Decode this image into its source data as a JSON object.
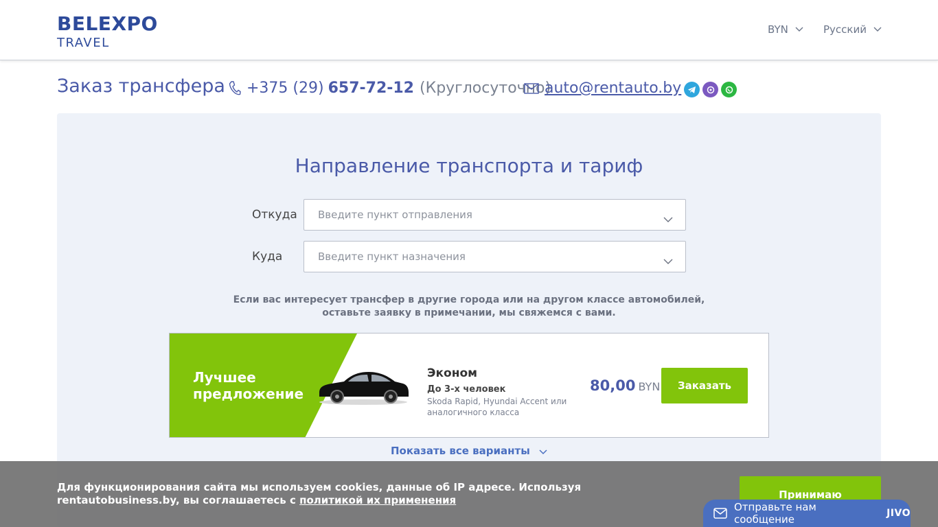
{
  "header": {
    "logo_top": "BELEXPO",
    "logo_bottom": "TRAVEL",
    "currency": "BYN",
    "language": "Русский"
  },
  "title_row": {
    "title": "Заказ трансфера",
    "phone_prefix": "+375 (29)",
    "phone_number": "657-72-12",
    "phone_note": "(Круглосуточно)",
    "email": "auto@rentauto.by"
  },
  "form": {
    "section_title": "Направление транспорта и тариф",
    "from_label": "Откуда",
    "from_placeholder": "Введите пункт отправления",
    "to_label": "Куда",
    "to_placeholder": "Введите пункт назначения",
    "hint_line1": "Если вас интересует трансфер в другие города или на другом классе автомобилей,",
    "hint_line2": "оставьте заявку в примечании, мы свяжемся с вами."
  },
  "offer": {
    "badge_line1": "Лучшее",
    "badge_line2": "предложение",
    "class_name": "Эконом",
    "capacity": "До 3-х человек",
    "models": "Skoda Rapid, Hyundai Accent или аналогичного класса",
    "price": "80,00",
    "currency": "BYN",
    "order_label": "Заказать"
  },
  "show_all": "Показать все варианты",
  "cookie": {
    "text": "Для функционирования сайта мы используем cookies, данные об IP адресе. Используя rentautobusiness.by, вы соглашаетесь с",
    "link": "политикой их применения",
    "accept": "Принимаю"
  },
  "chat": {
    "label": "Отправьте нам сообщение",
    "brand": "JIVO"
  },
  "colors": {
    "brand_blue": "#4a5aa8",
    "accent_green": "#82c40b",
    "panel_bg": "#eef2f9"
  }
}
